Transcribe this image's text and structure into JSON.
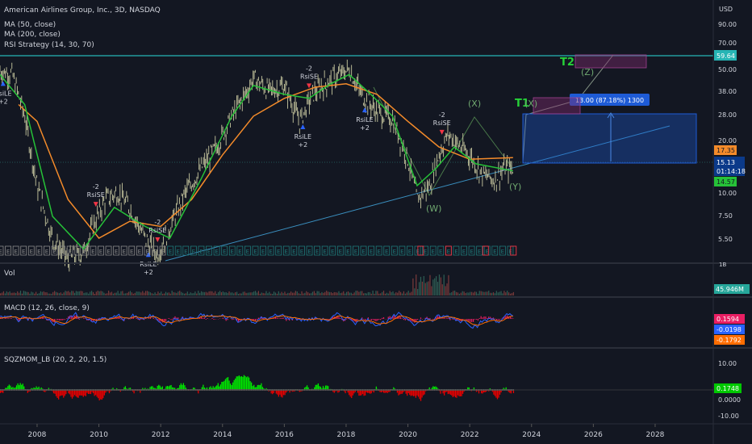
{
  "header": {
    "title": "American Airlines Group, Inc., 3D, NASDAQ",
    "indicators": [
      "MA (50, close)",
      "MA (200, close)",
      "RSI Strategy (14, 30, 70)"
    ]
  },
  "price_axis": {
    "currency": "USD",
    "ticks": [
      "90.00",
      "70.00",
      "50.00",
      "38.00",
      "28.00",
      "20.00",
      "10.00",
      "7.50",
      "5.50"
    ],
    "tags": {
      "level_line": "59.64",
      "ma200": "17.35",
      "last": "15.13",
      "countdown": "01:14:18",
      "ma50": "14.57"
    }
  },
  "x_axis": {
    "ticks": [
      "2008",
      "2010",
      "2012",
      "2014",
      "2016",
      "2018",
      "2020",
      "2022",
      "2024",
      "2026",
      "2028"
    ]
  },
  "annotations": {
    "sell_count": "-2",
    "sell_name": "RsiSE",
    "buy_name": "RsiLE",
    "buy_count": "+2",
    "wave_W": "(W)",
    "wave_X": "(X)",
    "wave_Y": "(Y)",
    "wave_Z": "(Z)",
    "target1": "T1",
    "target2": "T2",
    "measure_box": "13.00 (87.18%) 1300",
    "earnings_glyph": "E"
  },
  "volume": {
    "label": "Vol",
    "axis_tick": "1B",
    "value": "45.946M"
  },
  "macd": {
    "label": "MACD (12, 26, close, 9)",
    "hist_value": "0.1594",
    "macd_value": "-0.0198",
    "signal_value": "-0.1792"
  },
  "sqzmom": {
    "label": "SQZMOM_LB (20, 2, 20, 1.5)",
    "value": "0.1748",
    "ticks": [
      "10.00",
      "0.0000",
      "-10.00"
    ]
  },
  "colors": {
    "bg": "#131722",
    "candles": "#c8c8a0",
    "ma50": "#26c238",
    "ma200": "#f48b2a",
    "level": "#26b5b5",
    "trend": "#3a8fbf",
    "buy": "#2962ff",
    "sell": "#f23645",
    "macd_line": "#2962ff",
    "signal_line": "#ff6d00",
    "macd_hist": "#e91e63",
    "sqz_pos": "#00e600",
    "sqz_neg": "#e60000",
    "last_tag": "#0b3a8a",
    "measure": "#1e5bd6"
  },
  "chart_data": {
    "type": "line",
    "scale": "log",
    "series": [
      {
        "name": "AAL",
        "x": [
          2006.8,
          2007.2,
          2007.6,
          2008.0,
          2008.5,
          2009.0,
          2009.5,
          2009.8,
          2010.2,
          2010.6,
          2011.0,
          2011.5,
          2011.9,
          2012.3,
          2012.8,
          2013.3,
          2013.8,
          2014.3,
          2014.8,
          2015.0,
          2015.5,
          2016.0,
          2016.5,
          2016.9,
          2017.3,
          2017.8,
          2018.1,
          2018.5,
          2019.0,
          2019.5,
          2020.0,
          2020.3,
          2020.7,
          2021.0,
          2021.3,
          2021.7,
          2022.0,
          2022.4,
          2022.8,
          2023.1,
          2023.4
        ],
        "y": [
          55,
          52,
          30,
          12,
          6,
          4.5,
          5,
          7,
          10,
          11,
          9,
          6,
          4.8,
          7,
          11,
          15,
          20,
          30,
          42,
          50,
          42,
          45,
          28,
          40,
          46,
          52,
          56,
          40,
          32,
          29,
          17,
          10,
          12,
          18,
          24,
          20,
          18,
          14,
          13,
          15,
          15.13
        ]
      },
      {
        "name": "MA (50, close)",
        "x": [
          2006.8,
          2007.6,
          2008.5,
          2009.5,
          2010.5,
          2011.5,
          2012.3,
          2013.3,
          2014.3,
          2015.0,
          2016.0,
          2016.8,
          2017.5,
          2018.1,
          2018.8,
          2019.5,
          2020.3,
          2020.9,
          2021.5,
          2022.2,
          2023.4
        ],
        "y": [
          52,
          35,
          8,
          5.2,
          9,
          7,
          6,
          13,
          30,
          45,
          40,
          38,
          46,
          52,
          40,
          30,
          12,
          15,
          20,
          16,
          14.57
        ]
      },
      {
        "name": "MA (200, close)",
        "x": [
          2007.4,
          2008.0,
          2009.0,
          2010.0,
          2011.0,
          2012.0,
          2013.0,
          2014.0,
          2015.0,
          2016.0,
          2017.0,
          2018.0,
          2019.0,
          2020.0,
          2021.0,
          2022.0,
          2023.4
        ],
        "y": [
          35,
          28,
          10,
          6,
          7.5,
          7,
          10,
          18,
          30,
          38,
          44,
          46,
          40,
          28,
          20,
          17,
          17.35
        ]
      }
    ],
    "xlim": [
      2006.8,
      2029.6
    ],
    "ylim": [
      4.5,
      110
    ]
  }
}
